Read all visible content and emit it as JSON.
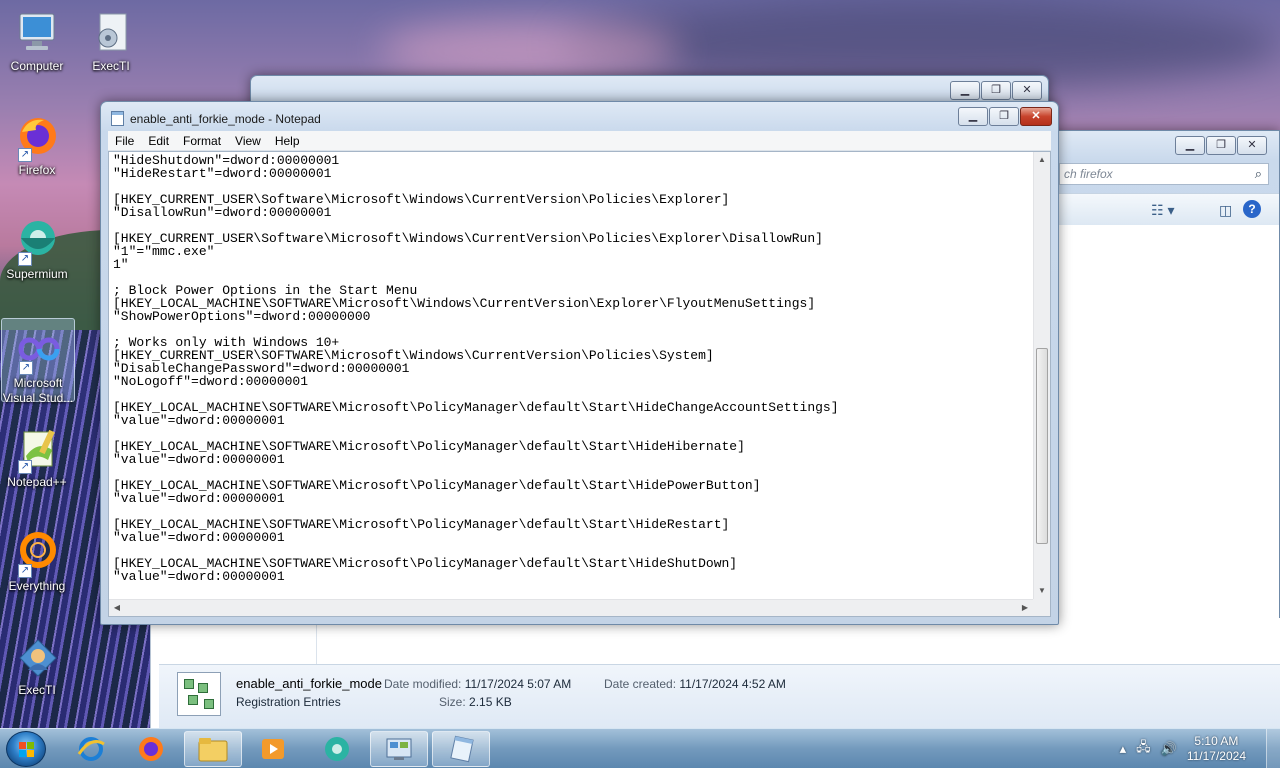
{
  "desktop": {
    "icons": [
      {
        "label": "Computer",
        "icon": "computer-icon"
      },
      {
        "label": "ExecTI",
        "icon": "execti-icon"
      },
      {
        "label": "Firefox",
        "icon": "firefox-icon"
      },
      {
        "label": "Supermium",
        "icon": "supermium-icon"
      },
      {
        "label": "Microsoft Visual Stud...",
        "label_line1": "Microsoft",
        "label_line2": "Visual Stud...",
        "icon": "visual-studio-icon"
      },
      {
        "label": "Notepad++",
        "icon": "notepadpp-icon"
      },
      {
        "label": "Everything",
        "icon": "everything-icon"
      },
      {
        "label": "ExecTI",
        "icon": "execti-icon"
      }
    ]
  },
  "notepad": {
    "title": "enable_anti_forkie_mode - Notepad",
    "menu": [
      "File",
      "Edit",
      "Format",
      "View",
      "Help"
    ],
    "lines": [
      "\"HideShutdown\"=dword:00000001",
      "\"HideRestart\"=dword:00000001",
      "",
      "[HKEY_CURRENT_USER\\Software\\Microsoft\\Windows\\CurrentVersion\\Policies\\Explorer]",
      "\"DisallowRun\"=dword:00000001",
      "",
      "[HKEY_CURRENT_USER\\Software\\Microsoft\\Windows\\CurrentVersion\\Policies\\Explorer\\DisallowRun]",
      "\"1\"=\"mmc.exe\"",
      "1\"",
      "",
      "; Block Power Options in the Start Menu",
      "[HKEY_LOCAL_MACHINE\\SOFTWARE\\Microsoft\\Windows\\CurrentVersion\\Explorer\\FlyoutMenuSettings]",
      "\"ShowPowerOptions\"=dword:00000000",
      "",
      "; Works only with Windows 10+",
      "[HKEY_CURRENT_USER\\SOFTWARE\\Microsoft\\Windows\\CurrentVersion\\Policies\\System]",
      "\"DisableChangePassword\"=dword:00000001",
      "\"NoLogoff\"=dword:00000001",
      "",
      "[HKEY_LOCAL_MACHINE\\SOFTWARE\\Microsoft\\PolicyManager\\default\\Start\\HideChangeAccountSettings]",
      "\"value\"=dword:00000001",
      "",
      "[HKEY_LOCAL_MACHINE\\SOFTWARE\\Microsoft\\PolicyManager\\default\\Start\\HideHibernate]",
      "\"value\"=dword:00000001",
      "",
      "[HKEY_LOCAL_MACHINE\\SOFTWARE\\Microsoft\\PolicyManager\\default\\Start\\HidePowerButton]",
      "\"value\"=dword:00000001",
      "",
      "[HKEY_LOCAL_MACHINE\\SOFTWARE\\Microsoft\\PolicyManager\\default\\Start\\HideRestart]",
      "\"value\"=dword:00000001",
      "",
      "[HKEY_LOCAL_MACHINE\\SOFTWARE\\Microsoft\\PolicyManager\\default\\Start\\HideShutDown]",
      "\"value\"=dword:00000001"
    ]
  },
  "explorer": {
    "search_placeholder": "Search firefox",
    "search_visible": "ch firefox",
    "file": {
      "name": "enable_anti_forkie_mode",
      "type": "Registration Entries",
      "date_modified_label": "Date modified:",
      "date_modified": "11/17/2024 5:07 AM",
      "date_created_label": "Date created:",
      "date_created": "11/17/2024 4:52 AM",
      "size_label": "Size:",
      "size": "2.15 KB"
    }
  },
  "taskbar": {
    "pinned": [
      "internet-explorer-icon",
      "firefox-icon",
      "file-explorer-icon",
      "media-player-icon",
      "supermium-icon",
      "control-panel-icon",
      "notepad-icon"
    ],
    "clock_time": "5:10 AM",
    "clock_date": "11/17/2024"
  }
}
